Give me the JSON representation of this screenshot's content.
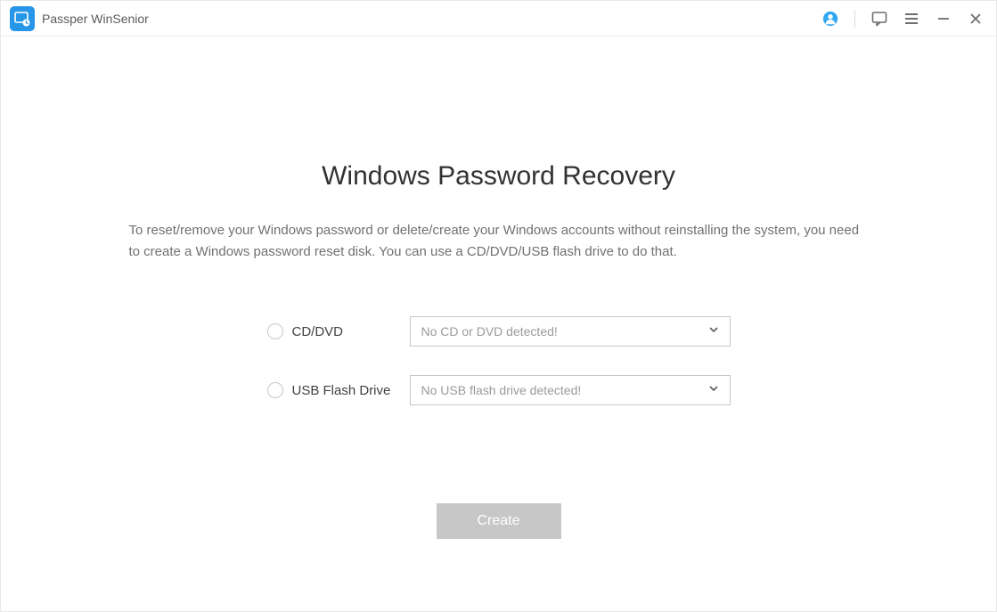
{
  "titlebar": {
    "app_title": "Passper WinSenior"
  },
  "main": {
    "heading": "Windows Password Recovery",
    "description": "To reset/remove your Windows password or delete/create your Windows accounts without reinstalling the system, you need to create a Windows password reset disk. You can use a CD/DVD/USB flash drive to do that.",
    "options": {
      "cd_dvd": {
        "label": "CD/DVD",
        "placeholder": "No CD or DVD detected!"
      },
      "usb": {
        "label": "USB Flash Drive",
        "placeholder": "No USB flash drive detected!"
      }
    },
    "create_button": "Create"
  }
}
